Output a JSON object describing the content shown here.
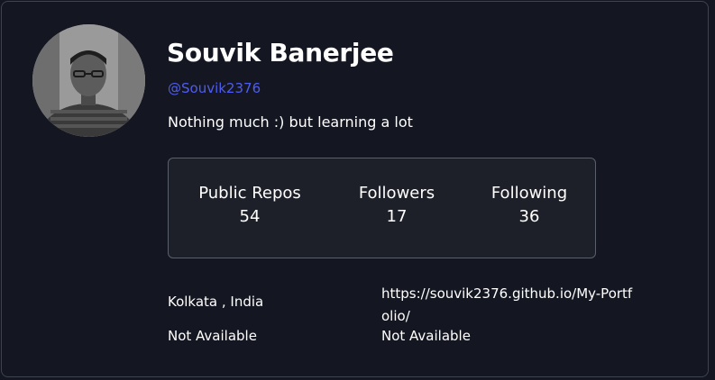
{
  "profile": {
    "name": "Souvik Banerjee",
    "login": "@Souvik2376",
    "bio": "Nothing much :) but learning a lot"
  },
  "stats": [
    {
      "label": "Public Repos",
      "value": "54"
    },
    {
      "label": "Followers",
      "value": "17"
    },
    {
      "label": "Following",
      "value": "36"
    }
  ],
  "links": {
    "location": "Kolkata , India",
    "blog": "https://souvik2376.github.io/My-Portfolio/",
    "twitter": "Not Available",
    "company": "Not Available"
  },
  "colors": {
    "background": "#141722",
    "accent": "#4f5cf0",
    "text": "#ffffff",
    "border": "#5a5f6c"
  }
}
